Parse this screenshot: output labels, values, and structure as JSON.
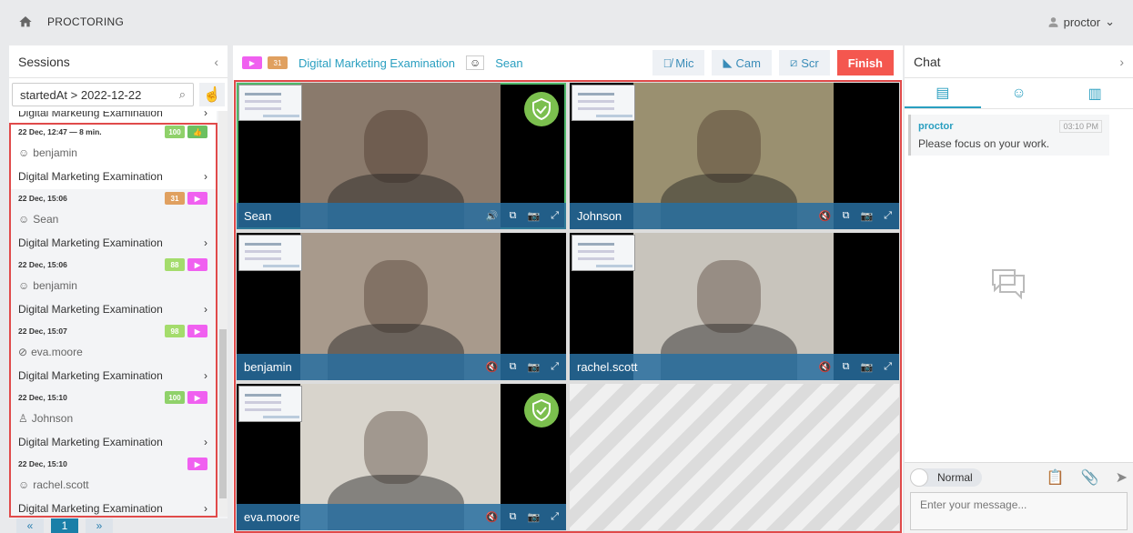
{
  "header": {
    "title": "PROCTORING",
    "user": "proctor"
  },
  "sessions": {
    "title": "Sessions",
    "search_value": "startedAt > 2022-12-22",
    "cut_exam": "Digital Marketing Examination",
    "items": [
      {
        "time": "22 Dec, 12:47 — 8 min.",
        "score": "100",
        "score_color": "#8fd16a",
        "status": "thumbs-up",
        "user": "benjamin",
        "user_icon": "face-icon",
        "exam": "Digital Marketing Examination",
        "selected": true
      },
      {
        "time": "22 Dec, 15:06",
        "score": "31",
        "score_color": "#e0a060",
        "status": "play",
        "user": "Sean",
        "user_icon": "face-icon",
        "exam": "Digital Marketing Examination"
      },
      {
        "time": "22 Dec, 15:06",
        "score": "88",
        "score_color": "#a4dc6c",
        "status": "play",
        "user": "benjamin",
        "user_icon": "face-icon",
        "exam": "Digital Marketing Examination"
      },
      {
        "time": "22 Dec, 15:07",
        "score": "98",
        "score_color": "#a4dc6c",
        "status": "play",
        "user": "eva.moore",
        "user_icon": "face-off-icon",
        "exam": "Digital Marketing Examination"
      },
      {
        "time": "22 Dec, 15:10",
        "score": "100",
        "score_color": "#8fd16a",
        "status": "play",
        "user": "Johnson",
        "user_icon": "person-icon",
        "exam": "Digital Marketing Examination"
      },
      {
        "time": "22 Dec, 15:10",
        "score": "",
        "status": "play",
        "user": "rachel.scott",
        "user_icon": "face-icon",
        "exam": "Digital Marketing Examination"
      }
    ],
    "pager": {
      "prev": "«",
      "page": "1",
      "next": "»"
    }
  },
  "main": {
    "score": "31",
    "exam": "Digital Marketing Examination",
    "user": "Sean",
    "mic": "Mic",
    "cam": "Cam",
    "scr": "Scr",
    "finish": "Finish",
    "tiles": [
      {
        "name": "Sean",
        "verified": true,
        "audio": "on",
        "bg": "#8a7a6c"
      },
      {
        "name": "Johnson",
        "verified": false,
        "audio": "muted",
        "bg": "#9a9070"
      },
      {
        "name": "benjamin",
        "verified": false,
        "audio": "muted",
        "bg": "#a89a8c"
      },
      {
        "name": "rachel.scott",
        "verified": false,
        "audio": "muted",
        "bg": "#c8c4bc"
      },
      {
        "name": "eva.moore",
        "verified": true,
        "audio": "muted",
        "bg": "#d8d4cc"
      }
    ]
  },
  "chat": {
    "title": "Chat",
    "messages": [
      {
        "from": "proctor",
        "time": "03:10 PM",
        "text": "Please focus on your work."
      }
    ],
    "mode": "Normal",
    "placeholder": "Enter your message..."
  },
  "colors": {
    "accent": "#2a9fc0",
    "finish": "#f4574f",
    "play": "#f060f0",
    "highlight": "#e04a4a"
  }
}
